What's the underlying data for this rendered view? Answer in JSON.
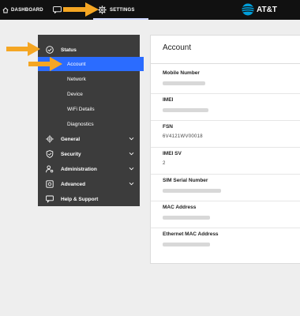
{
  "topbar": {
    "dashboard_label": "DASHBOARD",
    "settings_label": "SETTINGS",
    "brand": "AT&T"
  },
  "sidebar": {
    "status": "Status",
    "status_items": [
      "Account",
      "Network",
      "Device",
      "WiFi Details",
      "Diagnostics"
    ],
    "general": "General",
    "security": "Security",
    "administration": "Administration",
    "advanced": "Advanced",
    "help": "Help & Support"
  },
  "panel": {
    "title": "Account",
    "fields": [
      {
        "label": "Mobile Number",
        "value": ""
      },
      {
        "label": "IMEI",
        "value": ""
      },
      {
        "label": "FSN",
        "value": "6V4121WV00018"
      },
      {
        "label": "IMEI SV",
        "value": "2"
      },
      {
        "label": "SIM Serial Number",
        "value": ""
      },
      {
        "label": "MAC Address",
        "value": ""
      },
      {
        "label": "Ethernet MAC Address",
        "value": ""
      }
    ]
  },
  "colors": {
    "topbar": "#111111",
    "sidebar": "#3c3c3c",
    "active": "#2b6cff",
    "arrow": "#f5a623"
  }
}
